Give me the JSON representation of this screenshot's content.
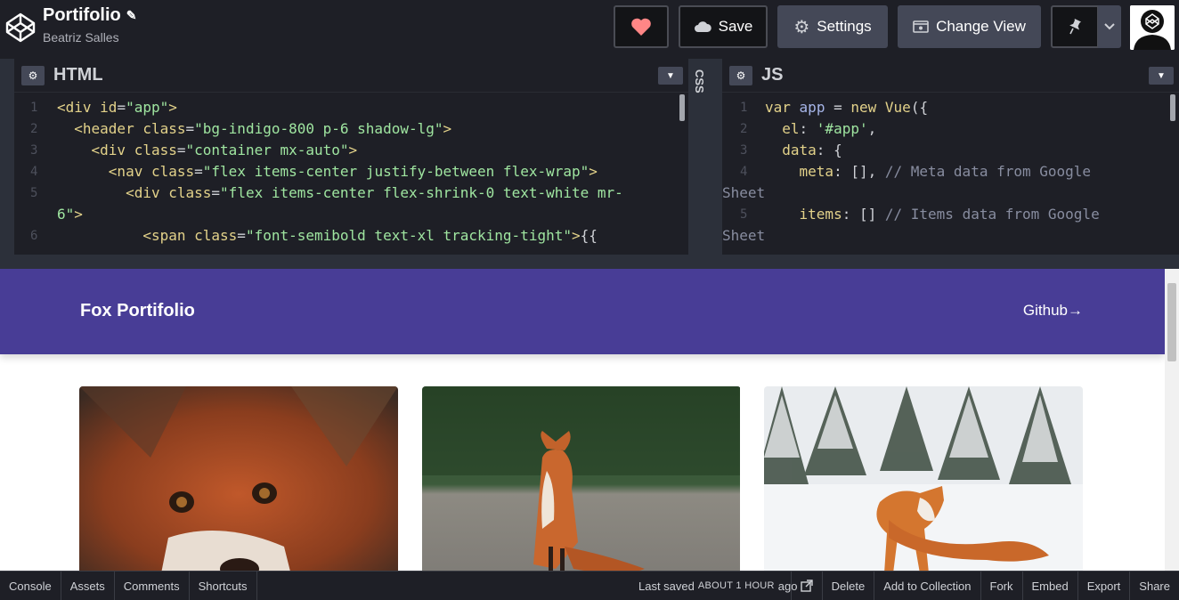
{
  "header": {
    "title": "Portifolio",
    "author": "Beatriz Salles",
    "buttons": {
      "save": "Save",
      "settings": "Settings",
      "change_view": "Change View"
    },
    "icons": [
      "codepen-logo-icon",
      "pencil-icon",
      "heart-icon",
      "cloud-icon",
      "gear-icon",
      "change-view-icon",
      "pin-icon",
      "chevron-down-icon"
    ],
    "colors": {
      "heart": "#ff8686",
      "accent_bg": "#444857"
    }
  },
  "editors": {
    "html": {
      "title": "HTML",
      "lines": [
        {
          "n": "1",
          "t": "<div id=\"app\">"
        },
        {
          "n": "2",
          "t": "  <header class=\"bg-indigo-800 p-6 shadow-lg\">"
        },
        {
          "n": "3",
          "t": "    <div class=\"container mx-auto\">"
        },
        {
          "n": "4",
          "t": "      <nav class=\"flex items-center justify-between flex-wrap\">"
        },
        {
          "n": "5",
          "t": "        <div class=\"flex items-center flex-shrink-0 text-white mr-"
        },
        {
          "n": "",
          "t": "6\">"
        },
        {
          "n": "6",
          "t": "          <span class=\"font-semibold text-xl tracking-tight\">{{"
        }
      ]
    },
    "css": {
      "title": "CSS"
    },
    "js": {
      "title": "JS",
      "lines": [
        {
          "n": "1",
          "t": "var app = new Vue({"
        },
        {
          "n": "2",
          "t": "  el: '#app',"
        },
        {
          "n": "3",
          "t": "  data: {"
        },
        {
          "n": "4",
          "t": "    meta: [], // Meta data from Google"
        },
        {
          "n": "",
          "t": "Sheet"
        },
        {
          "n": "5",
          "t": "    items: [] // Items data from Google"
        },
        {
          "n": "",
          "t": "Sheet"
        }
      ]
    }
  },
  "preview": {
    "site_title": "Fox Portifolio",
    "github_link": "Github→",
    "header_color": "#483d96",
    "cards": [
      {
        "name": "fox-closeup-image"
      },
      {
        "name": "fox-sitting-image"
      },
      {
        "name": "fox-in-snow-image"
      }
    ]
  },
  "footer": {
    "left": [
      "Console",
      "Assets",
      "Comments",
      "Shortcuts"
    ],
    "saved_prefix": "Last saved",
    "saved_time": "ABOUT 1 HOUR",
    "saved_suffix": "ago",
    "right": [
      "Delete",
      "Add to Collection",
      "Fork",
      "Embed",
      "Export",
      "Share"
    ]
  }
}
